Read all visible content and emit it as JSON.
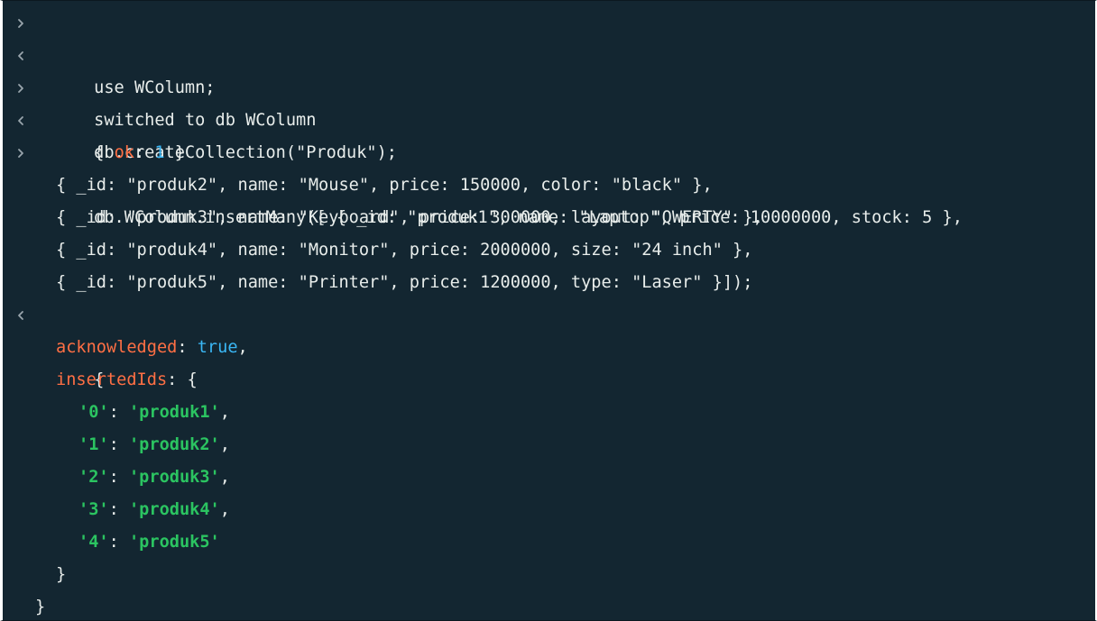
{
  "shell": {
    "lines": [
      {
        "type": "input",
        "text": "use WColumn;"
      },
      {
        "type": "output",
        "text": "switched to db WColumn"
      },
      {
        "type": "input",
        "text": "db.createCollection(\"Produk\");"
      },
      {
        "type": "output",
        "open": "{ ",
        "key": "ok",
        "sep": ": ",
        "value": "1",
        "close": " }"
      },
      {
        "type": "input",
        "text": "db.WColumn.insertMany([ { _id: \"produk1\", name: \"Laptop\", price: 10000000, stock: 5 },"
      },
      {
        "type": "cont",
        "text": "{ _id: \"produk2\", name: \"Mouse\", price: 150000, color: \"black\" },"
      },
      {
        "type": "cont",
        "text": "{ _id: \"produk3\", name: \"Keyboard\", price: 300000, layout: \"QWERTY\" },"
      },
      {
        "type": "cont",
        "text": "{ _id: \"produk4\", name: \"Monitor\", price: 2000000, size: \"24 inch\" },"
      },
      {
        "type": "cont",
        "text": "{ _id: \"produk5\", name: \"Printer\", price: 1200000, type: \"Laser\" }]);"
      },
      {
        "type": "output",
        "text": "{"
      },
      {
        "key": "acknowledged",
        "sep": ": ",
        "value": "true",
        "tail": ","
      },
      {
        "key": "insertedIds",
        "sep": ": ",
        "tail": "{"
      },
      {
        "key": "'0'",
        "sep": ": ",
        "value": "'produk1'",
        "tail": ","
      },
      {
        "key": "'1'",
        "sep": ": ",
        "value": "'produk2'",
        "tail": ","
      },
      {
        "key": "'2'",
        "sep": ": ",
        "value": "'produk3'",
        "tail": ","
      },
      {
        "key": "'3'",
        "sep": ": ",
        "value": "'produk4'",
        "tail": ","
      },
      {
        "key": "'4'",
        "sep": ": ",
        "value": "'produk5'",
        "tail": ""
      },
      {
        "text": "}"
      },
      {
        "text": "}"
      }
    ]
  },
  "colors": {
    "background": "#132631",
    "text": "#e8edeb",
    "key": "#ff6f44",
    "number_bool": "#3ab7f5",
    "string": "#2bc461",
    "prompt_icon": "#9aa6ad"
  },
  "icons": {
    "input_prompt": "chevron-right-icon",
    "output_marker": "chevron-left-icon"
  }
}
